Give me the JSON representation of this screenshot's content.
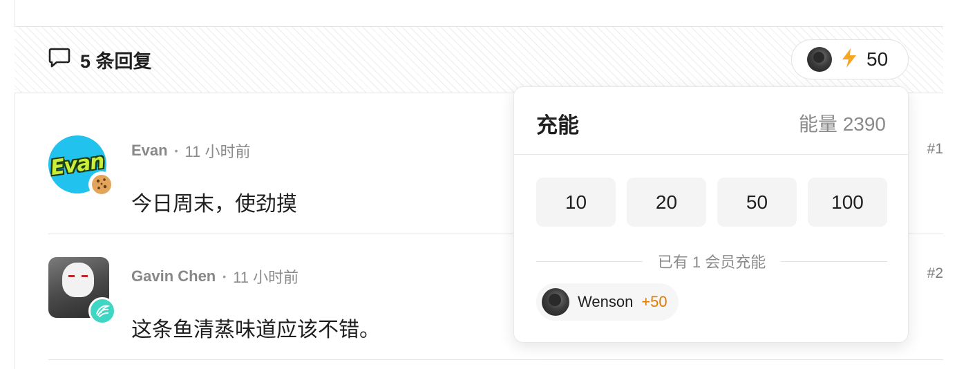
{
  "thread": {
    "reply_count_label": "5 条回复",
    "charge_count": "50"
  },
  "comments": [
    {
      "author": "Evan",
      "avatar_text": "Evan",
      "time": "11 小时前",
      "body": "今日周末，使劲摸",
      "floor": "#1"
    },
    {
      "author": "Gavin Chen",
      "time": "11 小时前",
      "body": "这条鱼清蒸味道应该不错。",
      "floor": "#2"
    }
  ],
  "charge_popover": {
    "title": "充能",
    "energy_label": "能量 2390",
    "amounts": [
      "10",
      "20",
      "50",
      "100"
    ],
    "members_label": "已有 1 会员充能",
    "members": [
      {
        "name": "Wenson",
        "amount": "+50"
      }
    ]
  },
  "colors": {
    "bolt": "#f5a623",
    "accent_orange": "#e07a00",
    "evan_avatar_bg": "#22c2ee",
    "gavin_badge": "#3fd6c4"
  },
  "icons": {
    "reply": "speech-bubble-icon",
    "charge": "lightning-bolt-icon",
    "evan_badge": "cookie-icon",
    "gavin_badge": "wing-icon"
  }
}
